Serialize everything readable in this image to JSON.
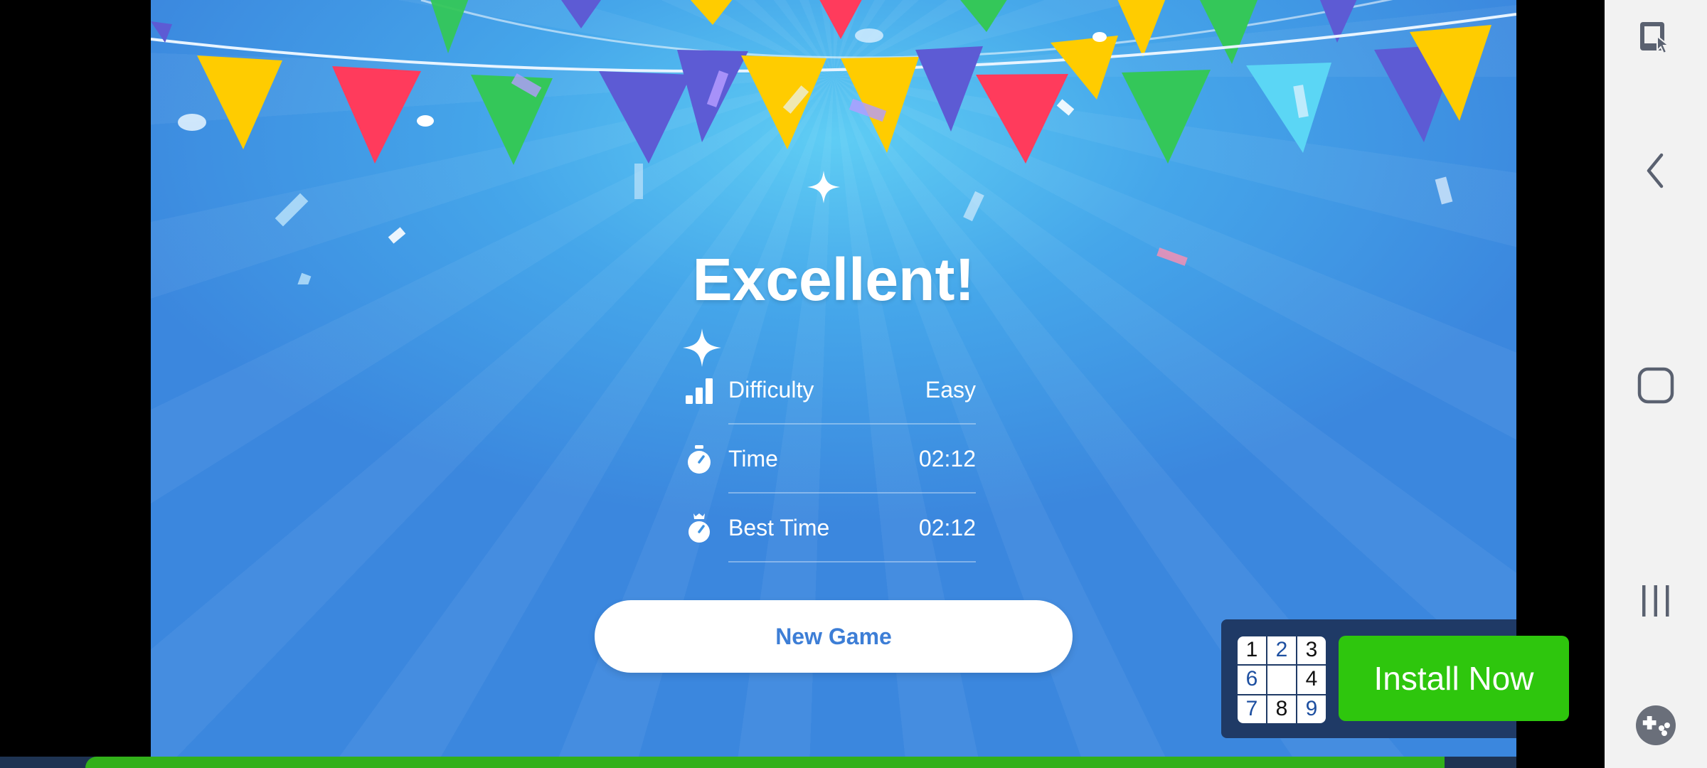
{
  "result": {
    "title": "Excellent!",
    "stats": [
      {
        "label": "Difficulty",
        "value": "Easy",
        "icon": "signal-bars-icon"
      },
      {
        "label": "Time",
        "value": "02:12",
        "icon": "stopwatch-icon"
      },
      {
        "label": "Best Time",
        "value": "02:12",
        "icon": "crown-stopwatch-icon"
      }
    ],
    "new_game_label": "New Game"
  },
  "ad": {
    "grid": [
      {
        "n": "1",
        "color": "dark"
      },
      {
        "n": "2",
        "color": "blue"
      },
      {
        "n": "3",
        "color": "dark"
      },
      {
        "n": "6",
        "color": "blue"
      },
      {
        "n": "",
        "color": "dark"
      },
      {
        "n": "4",
        "color": "dark"
      },
      {
        "n": "7",
        "color": "blue"
      },
      {
        "n": "8",
        "color": "dark"
      },
      {
        "n": "9",
        "color": "blue"
      }
    ],
    "install_label": "Install Now",
    "install_color": "#2ec60d"
  },
  "progress": {
    "fraction": 0.95,
    "fill_color": "#32b01a"
  },
  "nav": {
    "buttons": [
      "screen-pin-icon",
      "back-icon",
      "home-icon",
      "recents-icon",
      "game-tools-icon"
    ]
  },
  "colors": {
    "bg_top": "#5fcdf4",
    "bg_bottom": "#3b87de",
    "button_text": "#3d7ed6",
    "ad_panel": "#1f3a66"
  }
}
